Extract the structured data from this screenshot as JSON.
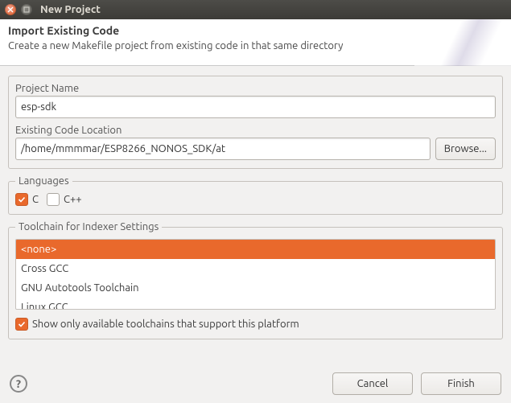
{
  "window": {
    "title": "New Project"
  },
  "header": {
    "title": "Import Existing Code",
    "subtitle": "Create a new Makefile project from existing code in that same directory"
  },
  "project": {
    "name_label": "Project Name",
    "name_value": "esp-sdk",
    "loc_label": "Existing Code Location",
    "loc_value": "/home/mmmmar/ESP8266_NONOS_SDK/at",
    "browse_label": "Browse..."
  },
  "languages": {
    "legend": "Languages",
    "c_label": "C",
    "cpp_label": "C++"
  },
  "toolchain": {
    "legend": "Toolchain for Indexer Settings",
    "items": [
      "<none>",
      "Cross GCC",
      "GNU Autotools Toolchain",
      "Linux GCC"
    ],
    "selected_index": 0,
    "show_only_label": "Show only available toolchains that support this platform"
  },
  "footer": {
    "help_label": "?",
    "cancel_label": "Cancel",
    "finish_label": "Finish"
  }
}
